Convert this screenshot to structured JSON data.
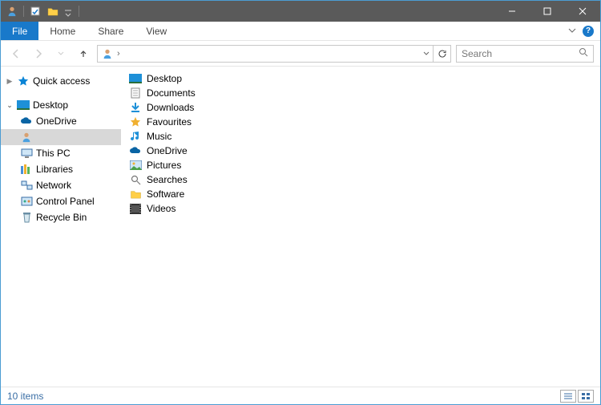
{
  "ribbon": {
    "file": "File",
    "home": "Home",
    "share": "Share",
    "view": "View"
  },
  "search": {
    "placeholder": "Search"
  },
  "breadcrumb": {
    "sep": "›"
  },
  "tree": {
    "quick": {
      "label": "Quick access"
    },
    "desktop": {
      "label": "Desktop"
    },
    "onedrive": {
      "label": "OneDrive"
    },
    "user": {
      "label": ""
    },
    "thispc": {
      "label": "This PC"
    },
    "libraries": {
      "label": "Libraries"
    },
    "network": {
      "label": "Network"
    },
    "controlpanel": {
      "label": "Control Panel"
    },
    "recyclebin": {
      "label": "Recycle Bin"
    }
  },
  "items": {
    "0": "Desktop",
    "1": "Documents",
    "2": "Downloads",
    "3": "Favourites",
    "4": "Music",
    "5": "OneDrive",
    "6": "Pictures",
    "7": "Searches",
    "8": "Software",
    "9": "Videos"
  },
  "status": {
    "count": "10 items"
  }
}
